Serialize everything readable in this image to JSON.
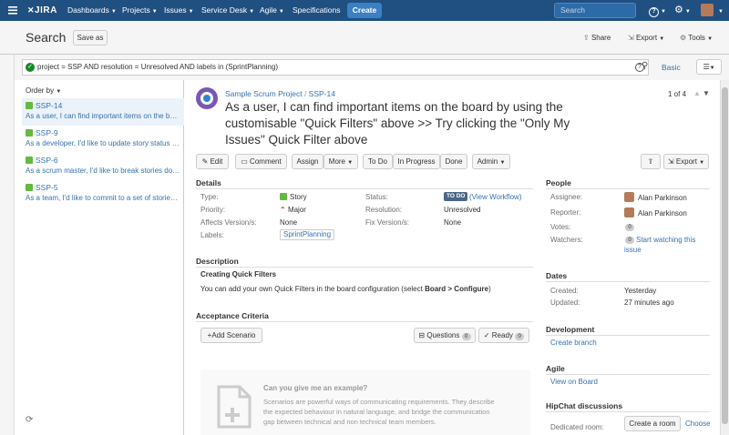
{
  "nav": {
    "logo": "JIRA",
    "items": [
      "Dashboards",
      "Projects",
      "Issues",
      "Service Desk",
      "Agile",
      "Specifications"
    ],
    "create": "Create",
    "search_placeholder": "Search",
    "help_icon": "?"
  },
  "header": {
    "title": "Search",
    "save_as": "Save as",
    "share": "Share",
    "export": "Export",
    "tools": "Tools"
  },
  "jql": {
    "query": "project = SSP AND resolution = Unresolved AND labels in (SprintPlanning)",
    "basic": "Basic"
  },
  "list": {
    "order_by": "Order by",
    "items": [
      {
        "key": "SSP-14",
        "summary": "As a user, I can find important items on the board by using the customisable \"Quick Filters\" above"
      },
      {
        "key": "SSP-9",
        "summary": "As a developer, I'd like to update story status during the sprint"
      },
      {
        "key": "SSP-6",
        "summary": "As a scrum master, I'd like to break stories down into tasks"
      },
      {
        "key": "SSP-5",
        "summary": "As a team, I'd like to commit to a set of stories to be completed"
      }
    ]
  },
  "issue": {
    "project": "Sample Scrum Project",
    "key": "SSP-14",
    "pager": "1 of 4",
    "title": "As a user, I can find important items on the board by using the customisable \"Quick Filters\" above >> Try clicking the \"Only My Issues\" Quick Filter above",
    "buttons": {
      "edit": "Edit",
      "comment": "Comment",
      "assign": "Assign",
      "more": "More",
      "todo": "To Do",
      "inprogress": "In Progress",
      "done": "Done",
      "admin": "Admin",
      "export": "Export"
    },
    "details": {
      "heading": "Details",
      "type_label": "Type:",
      "type": "Story",
      "priority_label": "Priority:",
      "priority": "Major",
      "affects_label": "Affects Version/s:",
      "affects": "None",
      "labels_label": "Labels:",
      "labels": "SprintPlanning",
      "status_label": "Status:",
      "status": "TO DO",
      "view_workflow": "(View Workflow)",
      "resolution_label": "Resolution:",
      "resolution": "Unresolved",
      "fix_label": "Fix Version/s:",
      "fix": "None"
    },
    "description": {
      "heading": "Description",
      "subheading": "Creating Quick Filters",
      "text_before": "You can add your own Quick Filters in the board configuration (select ",
      "text_bold": "Board > Configure",
      "text_after": ")"
    },
    "acceptance": {
      "heading": "Acceptance Criteria",
      "add": "Add Scenario",
      "questions": "Questions",
      "questions_count": "0",
      "ready": "Ready",
      "ready_count": "0",
      "example_title": "Can you give me an example?",
      "example_text": "Scenarios are powerful ways of communicating requirements. They describe the expected behaviour in natural language, and bridge the communication gap between technical and non technical team members."
    }
  },
  "side": {
    "people": "People",
    "assignee_label": "Assignee:",
    "assignee": "Alan Parkinson",
    "reporter_label": "Reporter:",
    "reporter": "Alan Parkinson",
    "votes_label": "Votes:",
    "votes": "0",
    "watchers_label": "Watchers:",
    "watchers": "0",
    "watch": "Start watching this issue",
    "dates": "Dates",
    "created_label": "Created:",
    "created": "Yesterday",
    "updated_label": "Updated:",
    "updated": "27 minutes ago",
    "development": "Development",
    "create_branch": "Create branch",
    "agile": "Agile",
    "view_board": "View on Board",
    "hipchat": "HipChat discussions",
    "dedicated_label": "Dedicated room:",
    "create_room": "Create a room",
    "choose": "Choose"
  },
  "colors": {
    "nav": "#205081",
    "link": "#3572b0",
    "status_todo": "#4a6785"
  }
}
